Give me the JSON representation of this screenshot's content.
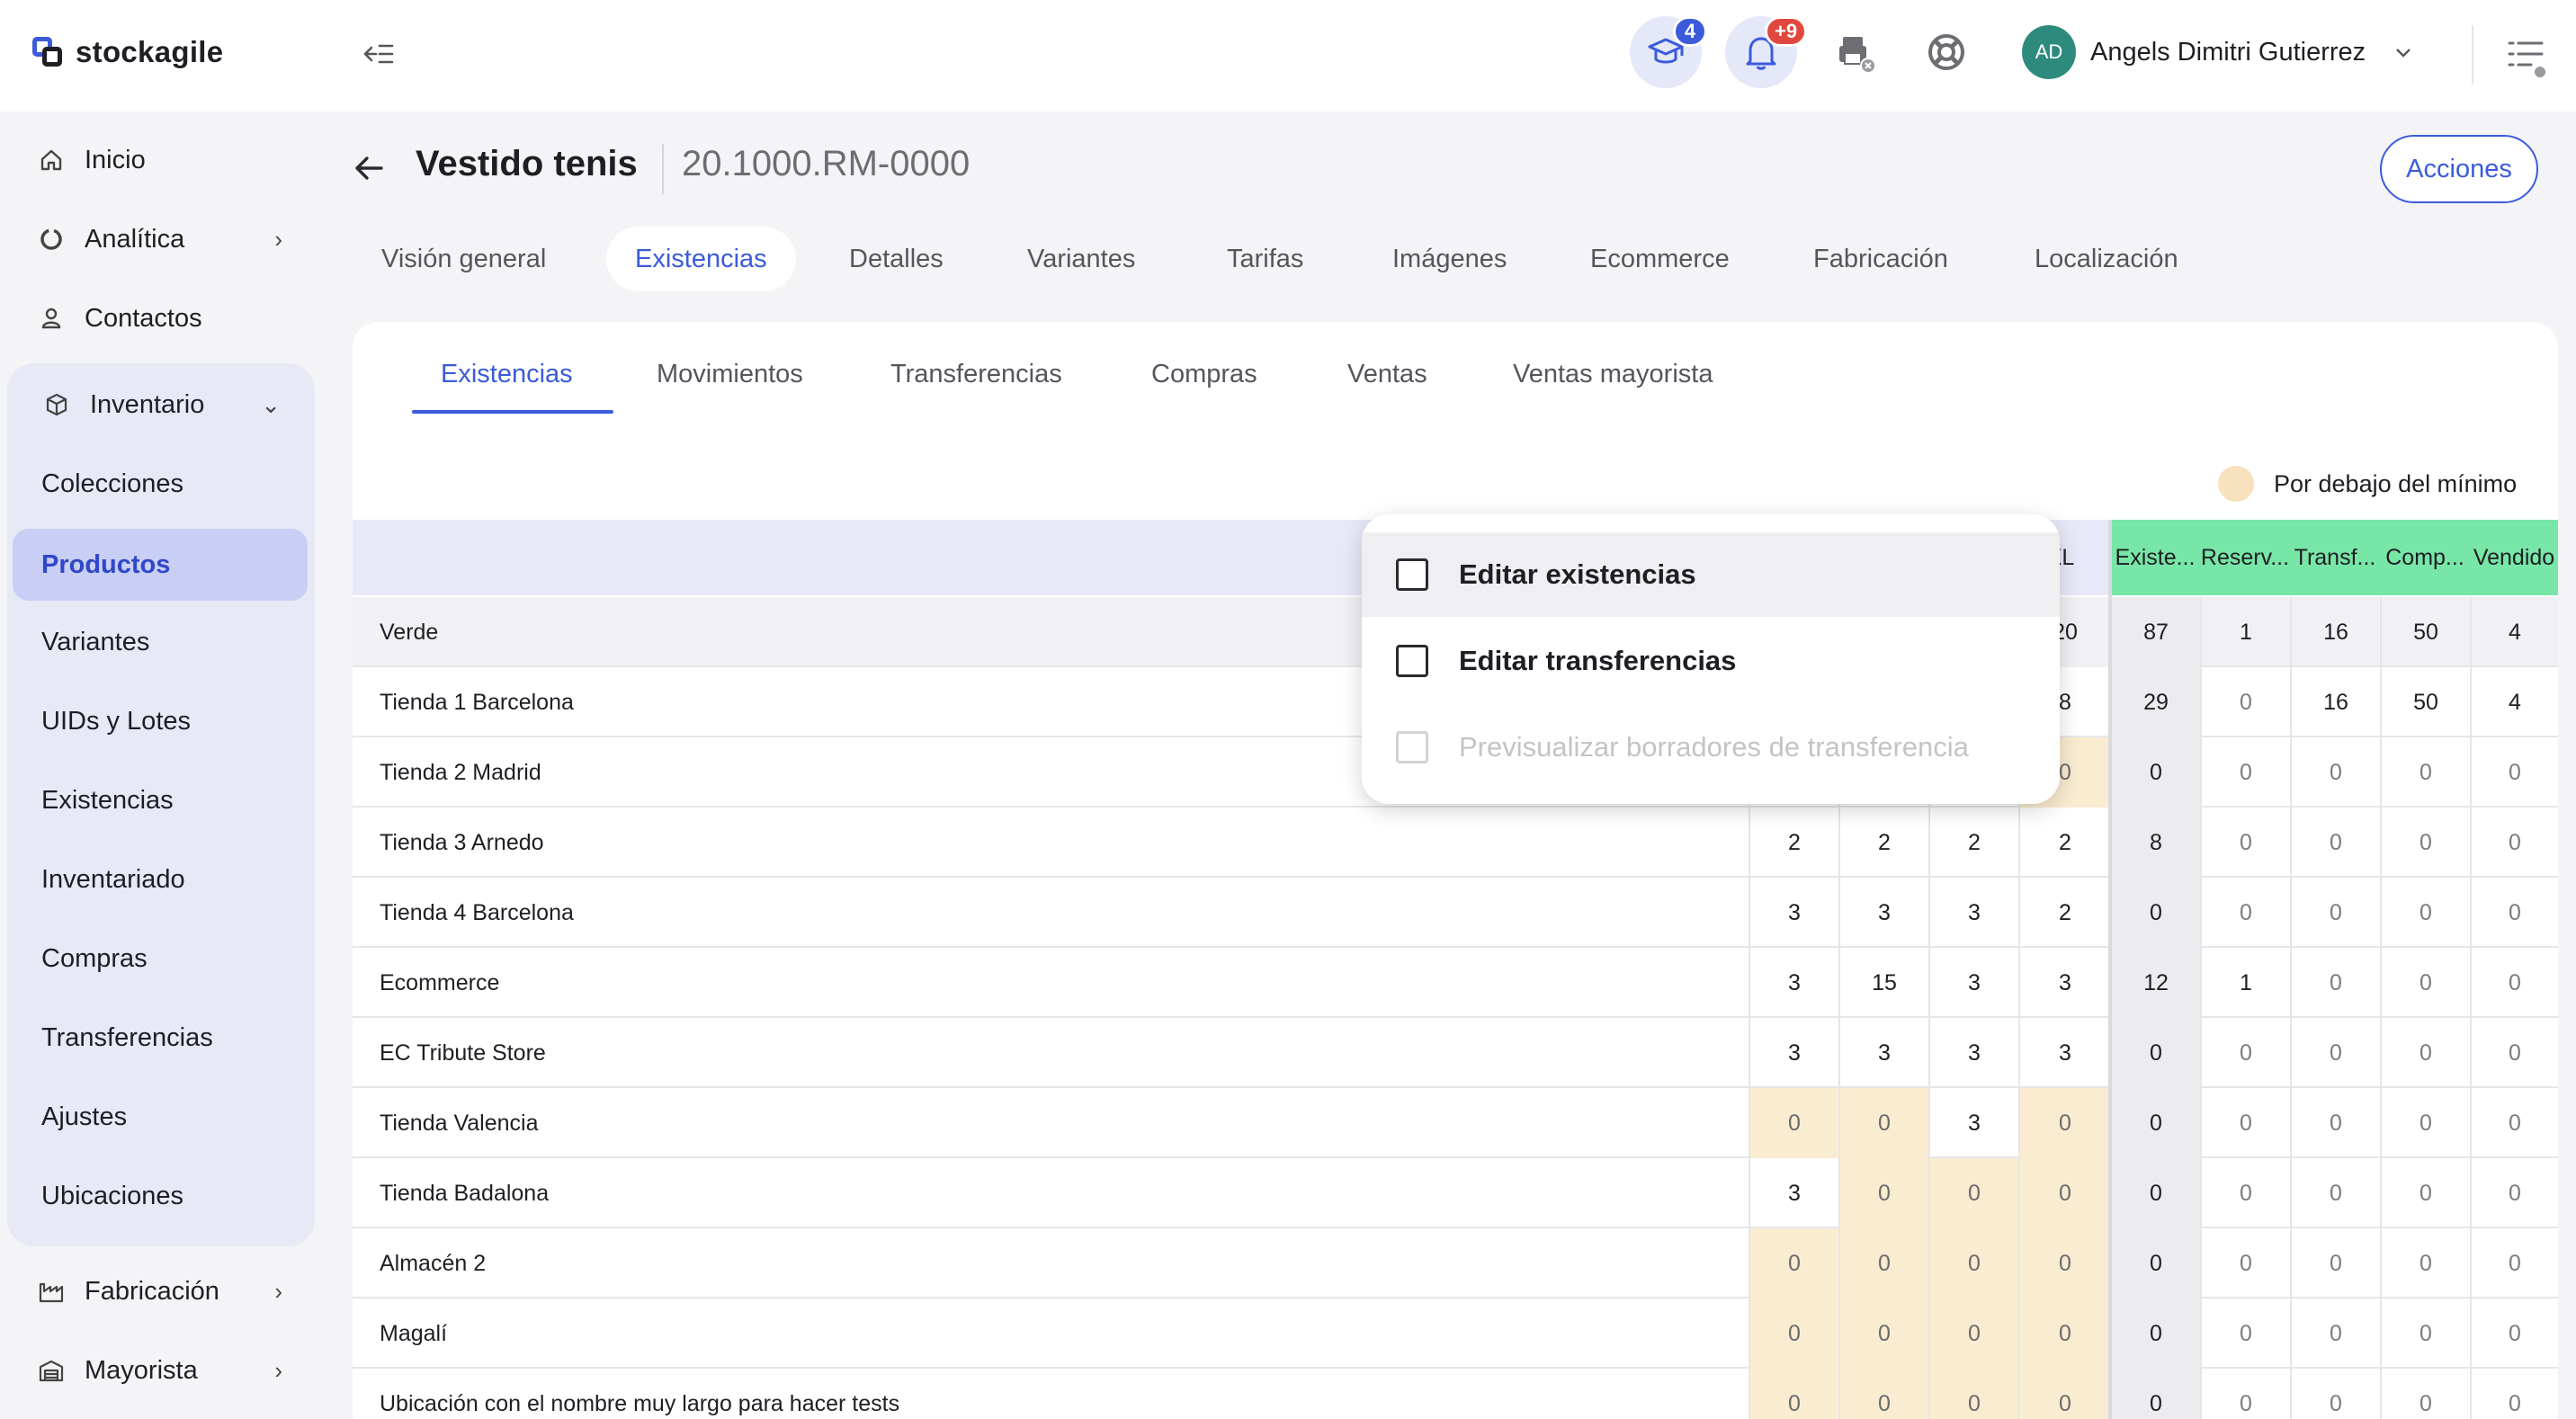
{
  "app": {
    "logo_text": "stockagile",
    "notifications": {
      "academy_count": "4",
      "alerts_count": "+9"
    },
    "user": {
      "initials": "AD",
      "name": "Angels Dimitri Gutierrez"
    },
    "colors": {
      "accent": "#3b5bdb",
      "badge_blue": "#3b5bdb",
      "badge_red": "#e0483e",
      "low_stock": "#faecd1",
      "green_header": "#77e6a6"
    }
  },
  "sidebar": {
    "inicio": "Inicio",
    "analitica": "Analítica",
    "contactos": "Contactos",
    "inventario": "Inventario",
    "inventario_items": [
      "Colecciones",
      "Productos",
      "Variantes",
      "UIDs y Lotes",
      "Existencias",
      "Inventariado",
      "Compras",
      "Transferencias",
      "Ajustes",
      "Ubicaciones"
    ],
    "fabricacion": "Fabricación",
    "mayorista": "Mayorista"
  },
  "header": {
    "title": "Vestido tenis",
    "reference": "20.1000.RM-0000",
    "actions_label": "Acciones",
    "tabs": [
      "Visión general",
      "Existencias",
      "Detalles",
      "Variantes",
      "Tarifas",
      "Imágenes",
      "Ecommerce",
      "Fabricación",
      "Localización"
    ]
  },
  "stock": {
    "subtabs": [
      "Existencias",
      "Movimientos",
      "Transferencias",
      "Compras",
      "Ventas",
      "Ventas mayorista"
    ],
    "legend_label": "Por debajo del mínimo",
    "size_header_visible": "XL",
    "summary_headers": [
      "Existe...",
      "Reserv...",
      "Transf...",
      "Comp...",
      "Vendido"
    ],
    "rows": [
      {
        "label": "Verde",
        "sizes": [
          "",
          "",
          "",
          "20"
        ],
        "summary": [
          "87",
          "1",
          "16",
          "50",
          "4"
        ]
      },
      {
        "label": "Tienda 1 Barcelona",
        "sizes": [
          "",
          "",
          "",
          "8"
        ],
        "summary": [
          "29",
          "0",
          "16",
          "50",
          "4"
        ]
      },
      {
        "label": "Tienda 2 Madrid",
        "sizes": [
          "",
          "",
          "",
          "0"
        ],
        "summary": [
          "0",
          "0",
          "0",
          "0",
          "0"
        ]
      },
      {
        "label": "Tienda 3 Arnedo",
        "sizes": [
          "2",
          "2",
          "2",
          "2"
        ],
        "summary": [
          "8",
          "0",
          "0",
          "0",
          "0"
        ]
      },
      {
        "label": "Tienda 4 Barcelona",
        "sizes": [
          "3",
          "3",
          "3",
          "2"
        ],
        "summary": [
          "0",
          "0",
          "0",
          "0",
          "0"
        ]
      },
      {
        "label": "Ecommerce",
        "sizes": [
          "3",
          "15",
          "3",
          "3"
        ],
        "summary": [
          "12",
          "1",
          "0",
          "0",
          "0"
        ]
      },
      {
        "label": "EC Tribute Store",
        "sizes": [
          "3",
          "3",
          "3",
          "3"
        ],
        "summary": [
          "0",
          "0",
          "0",
          "0",
          "0"
        ]
      },
      {
        "label": "Tienda Valencia",
        "sizes": [
          "0",
          "0",
          "3",
          "0"
        ],
        "summary": [
          "0",
          "0",
          "0",
          "0",
          "0"
        ]
      },
      {
        "label": "Tienda Badalona",
        "sizes": [
          "3",
          "0",
          "0",
          "0"
        ],
        "summary": [
          "0",
          "0",
          "0",
          "0",
          "0"
        ]
      },
      {
        "label": "Almacén 2",
        "sizes": [
          "0",
          "0",
          "0",
          "0"
        ],
        "summary": [
          "0",
          "0",
          "0",
          "0",
          "0"
        ]
      },
      {
        "label": "Magalí",
        "sizes": [
          "0",
          "0",
          "0",
          "0"
        ],
        "summary": [
          "0",
          "0",
          "0",
          "0",
          "0"
        ]
      },
      {
        "label": "Ubicación con el nombre muy largo para hacer tests",
        "sizes": [
          "0",
          "0",
          "0",
          "0"
        ],
        "summary": [
          "0",
          "0",
          "0",
          "0",
          "0"
        ]
      }
    ]
  },
  "popup": {
    "items": [
      "Editar existencias",
      "Editar transferencias",
      "Previsualizar borradores de transferencia"
    ]
  }
}
